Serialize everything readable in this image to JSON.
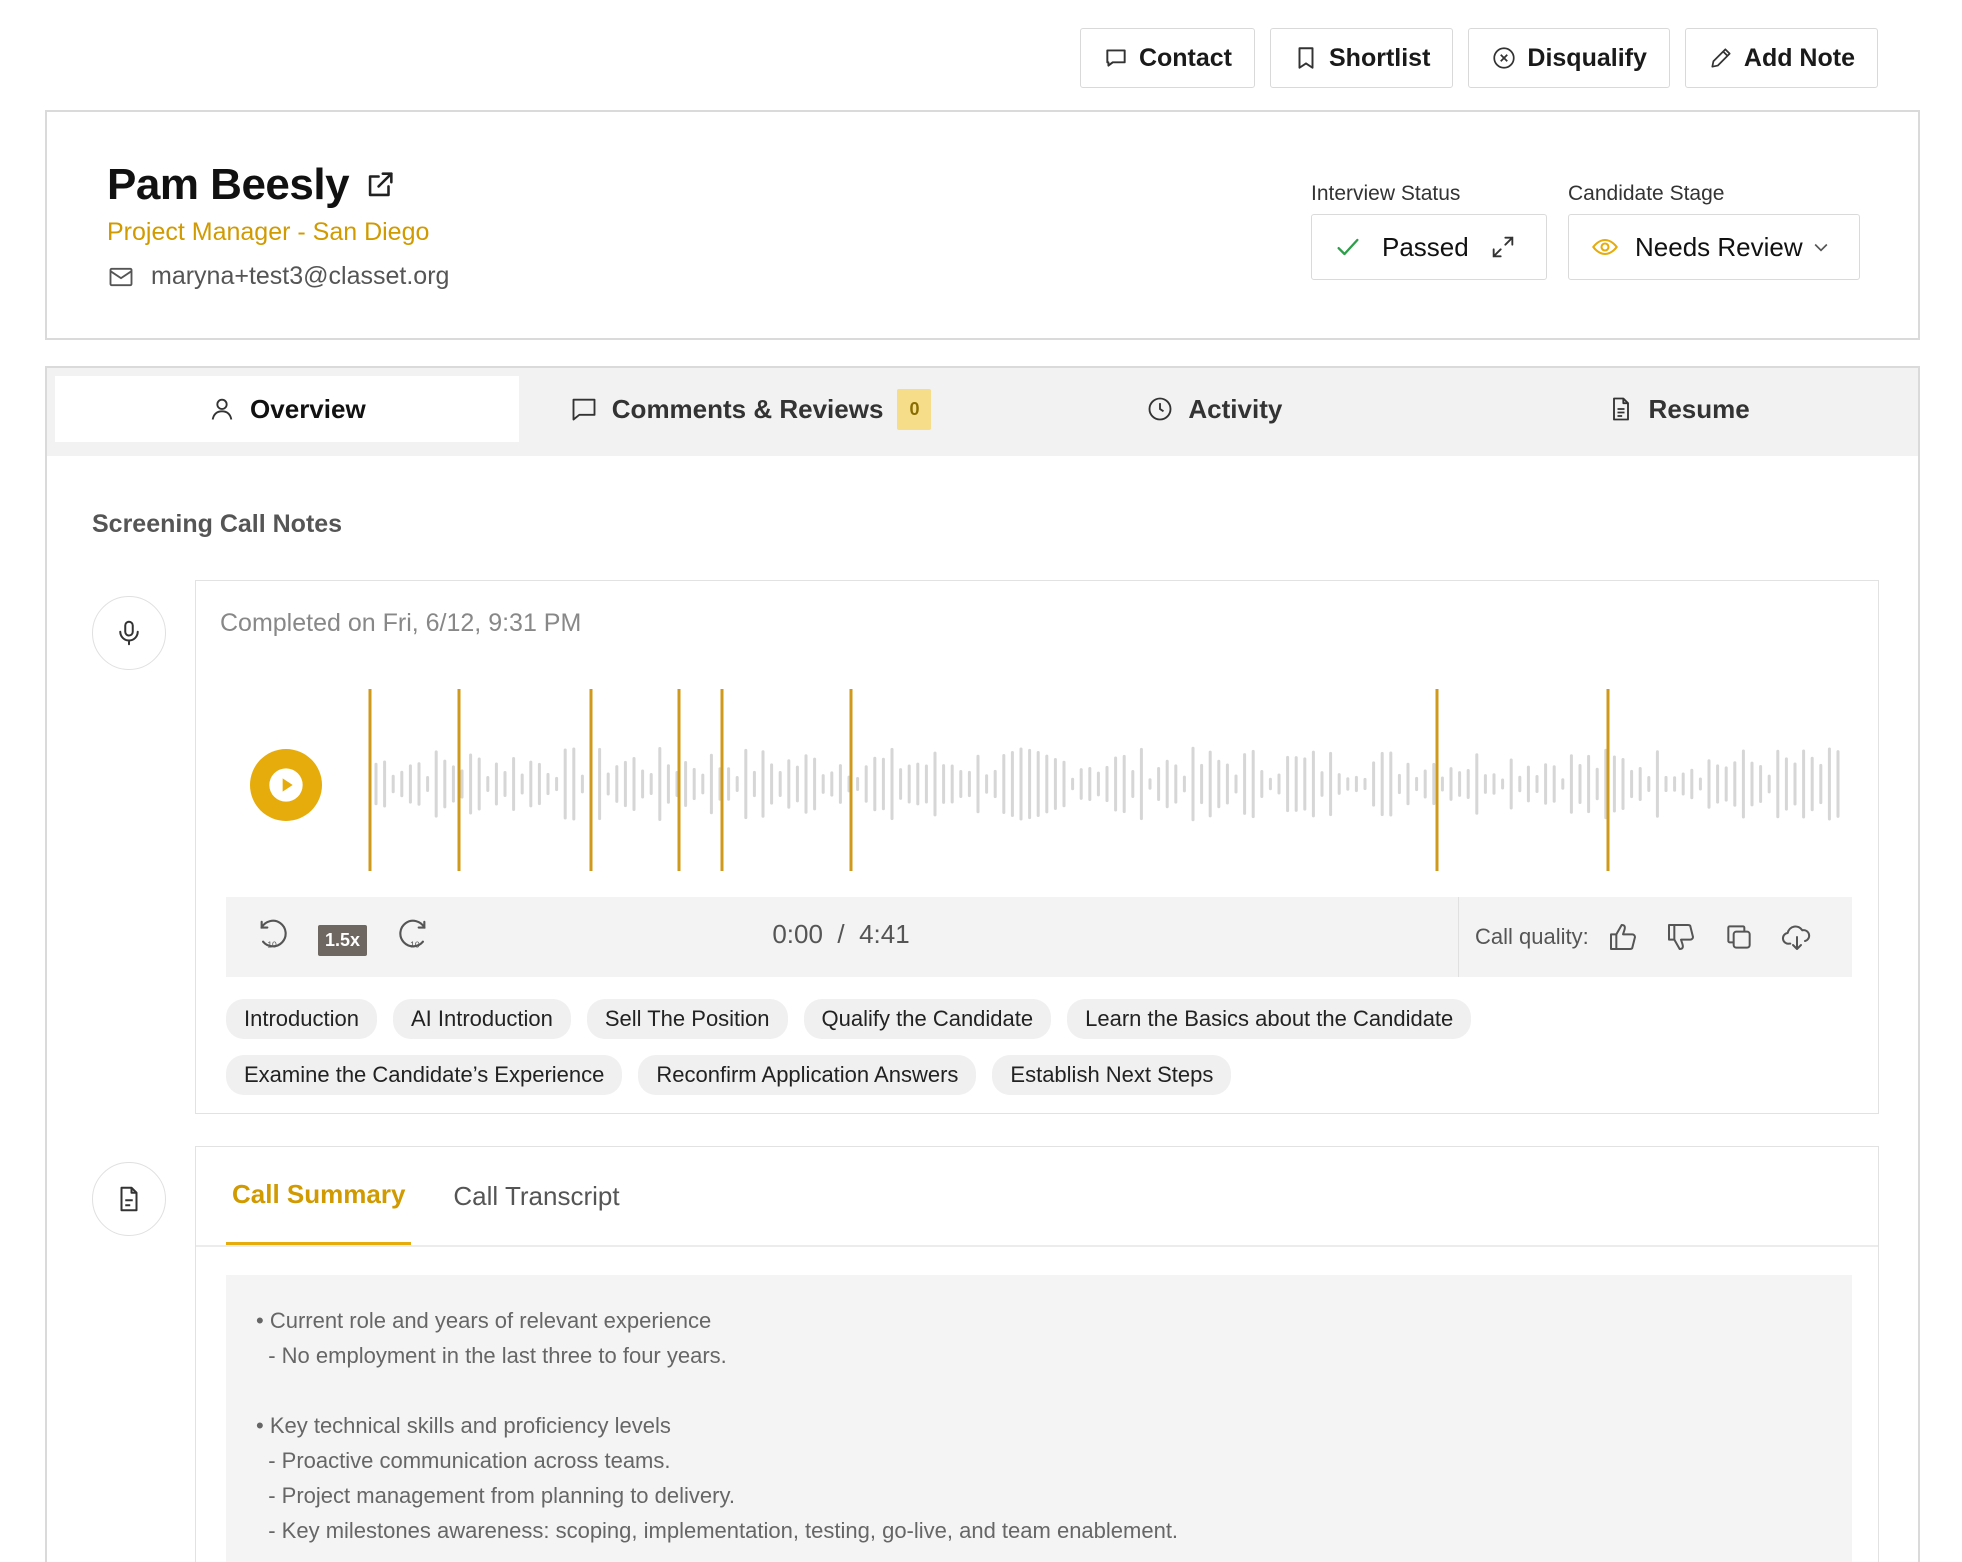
{
  "toolbar": {
    "buttons": [
      {
        "label": "Contact",
        "icon": "message-icon"
      },
      {
        "label": "Shortlist",
        "icon": "bookmark-icon"
      },
      {
        "label": "Disqualify",
        "icon": "x-circle-icon"
      },
      {
        "label": "Add Note",
        "icon": "pencil-icon"
      }
    ]
  },
  "candidate": {
    "name": "Pam Beesly",
    "role": "Project Manager - San Diego",
    "email": "maryna+test3@classet.org"
  },
  "interview_status": {
    "label": "Interview Status",
    "value": "Passed"
  },
  "candidate_stage": {
    "label": "Candidate Stage",
    "value": "Needs Review"
  },
  "tabs": [
    {
      "label": "Overview",
      "icon": "user-icon"
    },
    {
      "label": "Comments & Reviews",
      "icon": "comment-icon",
      "badge": "0"
    },
    {
      "label": "Activity",
      "icon": "clock-icon"
    },
    {
      "label": "Resume",
      "icon": "file-icon"
    }
  ],
  "screening": {
    "title": "Screening Call Notes",
    "completed": "Completed on Fri, 6/12, 9:31 PM",
    "speed": "1.5x",
    "time_current": "0:00",
    "time_separator": "/",
    "time_total": "4:41",
    "quality_label": "Call quality:",
    "chips": [
      "Introduction",
      "AI Introduction",
      "Sell The Position",
      "Qualify the Candidate",
      "Learn the Basics about the Candidate",
      "Examine the Candidate’s Experience",
      "Reconfirm Application Answers",
      "Establish Next Steps"
    ]
  },
  "summary": {
    "tabs": [
      "Call Summary",
      "Call Transcript"
    ],
    "body": "• Current role and years of relevant experience\n  - No employment in the last three to four years.\n\n• Key technical skills and proficiency levels\n  - Proactive communication across teams.\n  - Project management from planning to delivery.\n  - Key milestones awareness: scoping, implementation, testing, go-live, and team enablement."
  },
  "colors": {
    "accent": "#e6ac0c",
    "accent_text": "#d19a00",
    "success": "#2e9e4a"
  }
}
